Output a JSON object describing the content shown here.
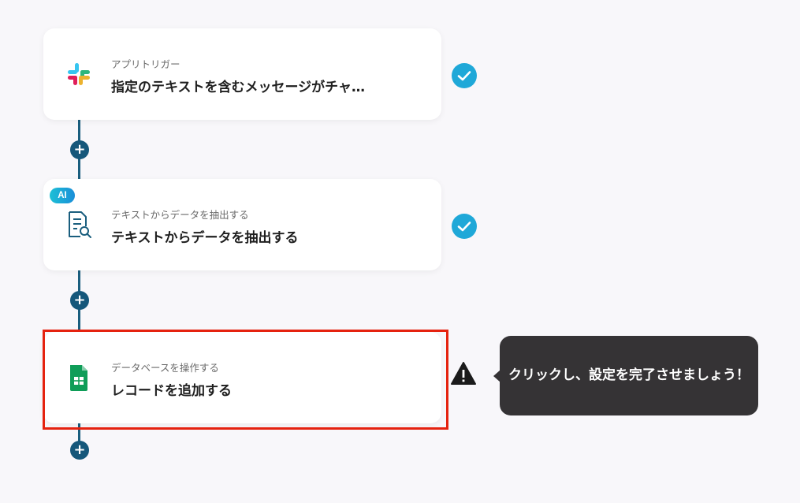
{
  "flow": {
    "steps": [
      {
        "subtitle": "アプリトリガー",
        "title": "指定のテキストを含むメッセージがチャ…",
        "icon": "slack-icon",
        "status": "complete"
      },
      {
        "badge": "AI",
        "subtitle": "テキストからデータを抽出する",
        "title": "テキストからデータを抽出する",
        "icon": "document-search-icon",
        "status": "complete"
      },
      {
        "subtitle": "データベースを操作する",
        "title": "レコードを追加する",
        "icon": "google-sheets-icon",
        "status": "warning"
      }
    ],
    "add_step_label": "+"
  },
  "tooltip": {
    "text": "クリックし、設定を完了させましょう！"
  },
  "colors": {
    "background": "#f8f7fa",
    "connector": "#1a5e7e",
    "check": "#1fa8d8",
    "highlight_border": "#e5220f",
    "tooltip_bg": "#353335"
  }
}
